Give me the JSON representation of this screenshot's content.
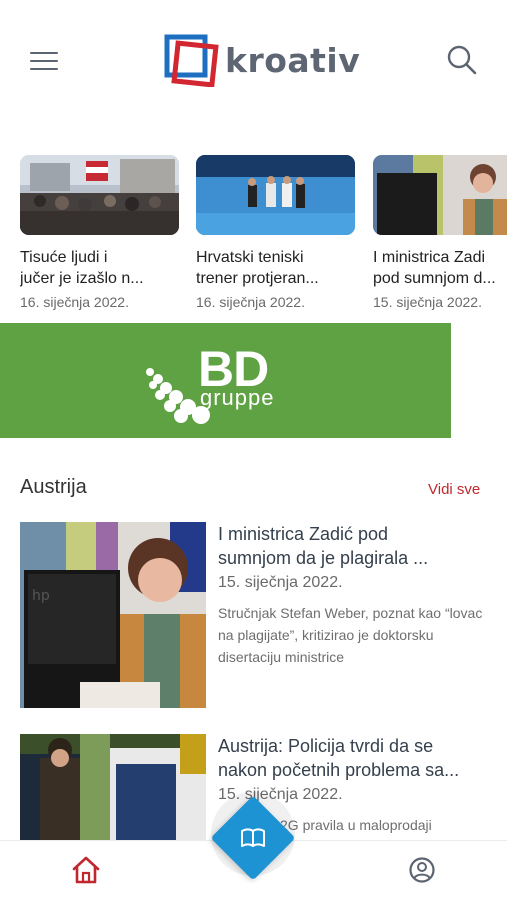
{
  "app": {
    "logo_text": "kroativ"
  },
  "carousel": {
    "items": [
      {
        "title_line1": "Tisuće ljudi i",
        "title_line2": "jučer je izašlo n...",
        "date": "16. siječnja 2022."
      },
      {
        "title_line1": "Hrvatski teniski",
        "title_line2": "trener protjeran...",
        "date": "16. siječnja 2022."
      },
      {
        "title_line1": "I ministrica Zadi",
        "title_line2": "pod sumnjom d...",
        "date": "15. siječnja 2022."
      }
    ]
  },
  "banner": {
    "brand_big": "BD",
    "brand_small": "gruppe",
    "color": "#5fa244"
  },
  "section": {
    "title": "Austrija",
    "see_all": "Vidi sve"
  },
  "articles": [
    {
      "title_line1": "I ministrica Zadić pod",
      "title_line2": "sumnjom da je plagirala ...",
      "date": "15. siječnja 2022.",
      "desc": "Stručnjak Stefan Weber, poznat kao “lovac na plagijate”, kritizirao je doktorsku disertaciju ministrice"
    },
    {
      "title_line1": "Austrija: Policija tvrdi da se",
      "title_line2": "nakon početnih problema sa...",
      "date": "15. siječnja 2022.",
      "desc": "2G pravila u maloprodaji"
    }
  ],
  "colors": {
    "accent_red": "#c0282d",
    "fab_blue": "#1e93d3",
    "banner_green": "#5fa244"
  },
  "icons": {
    "menu": "hamburger-icon",
    "search": "search-icon",
    "home": "home-icon",
    "reader": "book-icon",
    "profile": "user-circle-icon"
  }
}
